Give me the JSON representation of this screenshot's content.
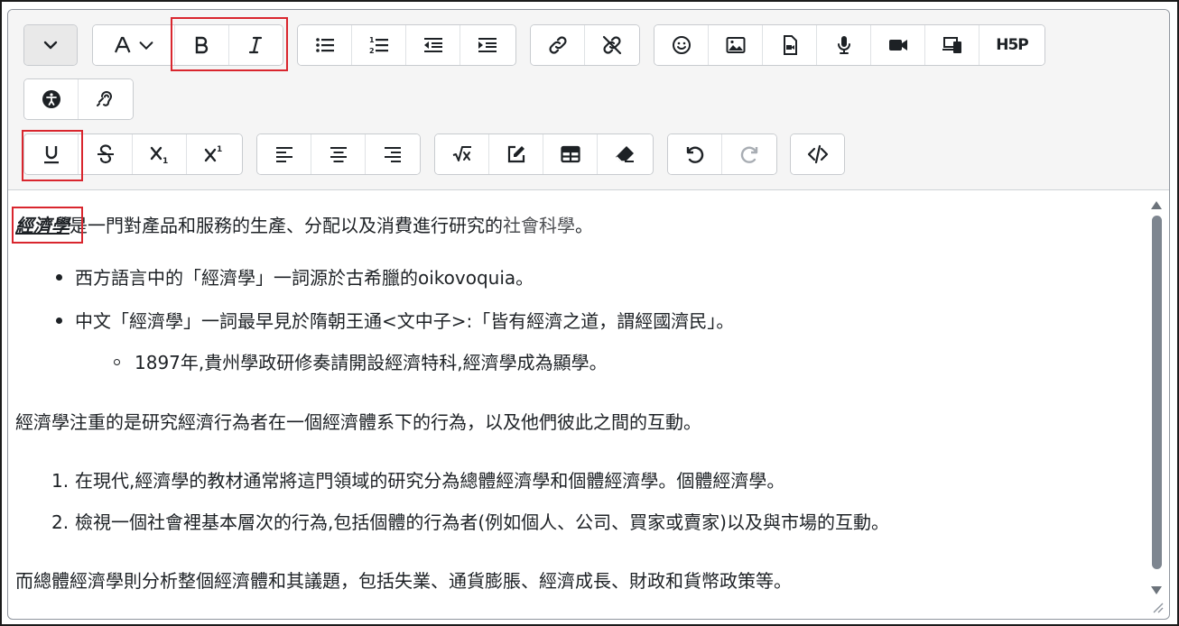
{
  "toolbar": {
    "toggle_tooltip": "",
    "h5p_label": "H5P"
  },
  "content": {
    "para1_keyword": "經濟學",
    "para1_rest_a": "是一門對產品和服務的生產、分配以及消費進行研究的",
    "para1_link": "社會科學",
    "para1_end": "。",
    "bullets": [
      "西方語言中的「經濟學」一詞源於古希臘的oikovoquia。",
      "中文「經濟學」一詞最早見於隋朝王通<文中子>:「皆有經濟之道，謂經國濟民」。"
    ],
    "sub_bullet": "1897年,貴州學政研修奏請開設經濟特科,經濟學成為顯學。",
    "para2": "經濟學注重的是研究經濟行為者在一個經濟體系下的行為，以及他們彼此之間的互動。",
    "numbers": [
      "1.",
      "2."
    ],
    "ordered": [
      "在現代,經濟學的教材通常將這門領域的研究分為總體經濟學和個體經濟學。個體經濟學。",
      "檢視一個社會裡基本層次的行為,包括個體的行為者(例如個人、公司、買家或賣家)以及與市場的互動。"
    ],
    "para3": "而總體經濟學則分析整個經濟體和其議題，包括失業、通貨膨脹、經濟成長、財政和貨幣政策等。"
  }
}
